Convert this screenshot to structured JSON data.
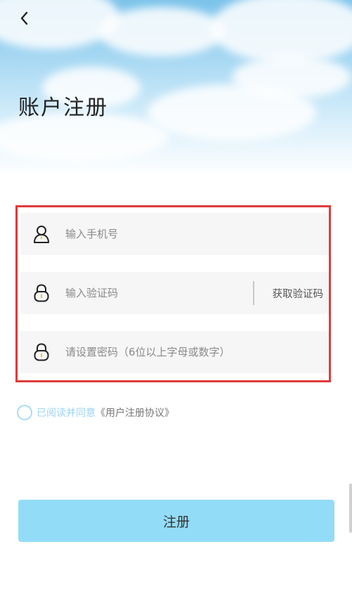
{
  "header": {
    "title": "账户注册"
  },
  "form": {
    "phone_placeholder": "输入手机号",
    "code_placeholder": "输入验证码",
    "get_code_label": "获取验证码",
    "password_placeholder": "请设置密码（6位以上字母或数字）"
  },
  "agreement": {
    "prefix": "已阅读并同意",
    "link": "《用户注册协议》",
    "checked": false
  },
  "submit_label": "注册",
  "colors": {
    "highlight_border": "#e03a3a",
    "button_bg": "#93dcf7",
    "radio_border": "#a7dcf5"
  },
  "icons": {
    "back": "chevron-left-icon",
    "phone": "user-icon",
    "code": "lock-icon",
    "password": "lock-icon"
  }
}
